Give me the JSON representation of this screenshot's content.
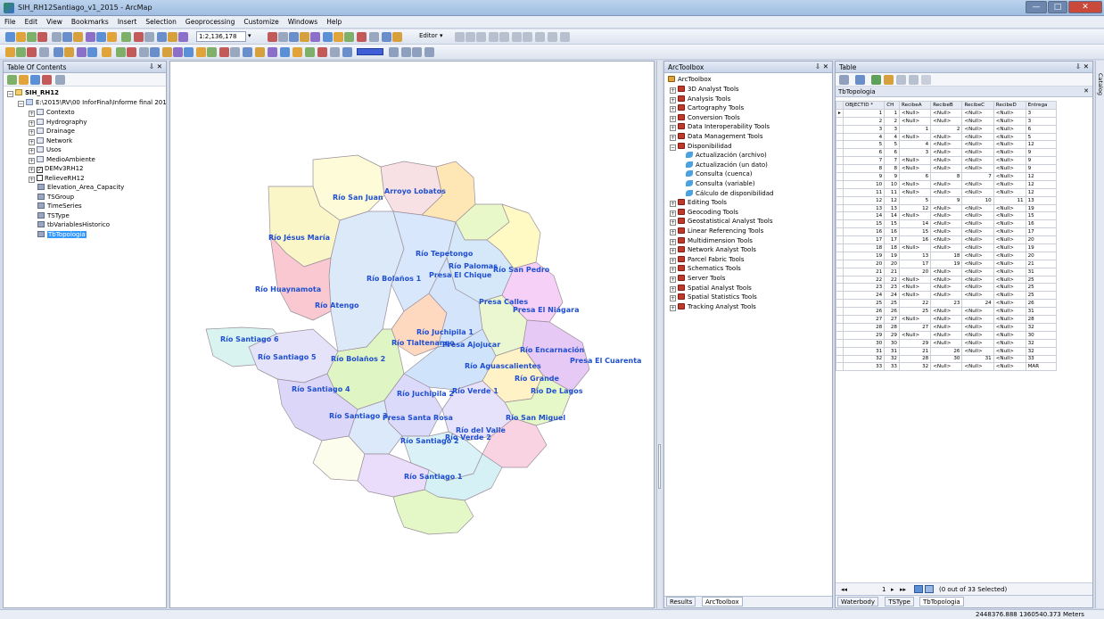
{
  "window": {
    "title": "SIH_RH12Santiago_v1_2015 - ArcMap"
  },
  "menu": [
    "File",
    "Edit",
    "View",
    "Bookmarks",
    "Insert",
    "Selection",
    "Geoprocessing",
    "Customize",
    "Windows",
    "Help"
  ],
  "toolbar": {
    "scale": "1:2,136,178",
    "editor_label": "Editor ▾"
  },
  "toc": {
    "title": "Table Of Contents",
    "root": "SIH_RH12",
    "path": "E:\\2015\\RV\\00 InforFinal\\Informe final 201",
    "groups": [
      "Contexto",
      "Hydrography",
      "Drainage",
      "Network",
      "Usos",
      "MedioAmbiente"
    ],
    "layers": [
      "DEMv3RH12",
      "RelieveRH12"
    ],
    "tables": [
      "Elevation_Area_Capacity",
      "TSGroup",
      "TimeSeries",
      "TSType",
      "tbVariablesHistorico",
      "TbTopologia"
    ]
  },
  "map": {
    "labels": [
      "Río San Juan",
      "Arroyo Lobatos",
      "Río Jésus María",
      "Río Tepetongo",
      "Río Palomas",
      "Presa El Chique",
      "Río San Pedro",
      "Río Bolaños 1",
      "Río Huaynamota",
      "Río Atengo",
      "Presa Calles",
      "Presa El Niágara",
      "Río Juchipila 1",
      "Río Tlaltenango",
      "Presa Ajojucar",
      "Río Encarnación",
      "Río Santiago 6",
      "Río Santiago 5",
      "Río Bolaños 2",
      "Río Aguascalientes",
      "Presa El Cuarenta",
      "Río Grande",
      "Río De Lagos",
      "Río Santiago 4",
      "Río Juchipila 2",
      "Río Verde 1",
      "Río Santiago 3",
      "Presa Santa Rosa",
      "Río San Miguel",
      "Río del Valle",
      "Río Santiago 2",
      "Río Verde 2",
      "Río Santiago 1"
    ]
  },
  "arctoolbox": {
    "title": "ArcToolbox",
    "root": "ArcToolbox",
    "before": [
      "3D Analyst Tools",
      "Analysis Tools",
      "Cartography Tools",
      "Conversion Tools",
      "Data Interoperability Tools",
      "Data Management Tools",
      "Disponibilidad"
    ],
    "tools": [
      "Actualización (archivo)",
      "Actualización (un dato)",
      "Consulta (cuenca)",
      "Consulta (variable)",
      "Cálculo de disponibilidad"
    ],
    "after": [
      "Editing Tools",
      "Geocoding Tools",
      "Geostatistical Analyst Tools",
      "Linear Referencing Tools",
      "Multidimension Tools",
      "Network Analyst Tools",
      "Parcel Fabric Tools",
      "Schematics Tools",
      "Server Tools",
      "Spatial Analyst Tools",
      "Spatial Statistics Tools",
      "Tracking Analyst Tools"
    ],
    "tabs": [
      "Results",
      "ArcToolbox"
    ]
  },
  "table": {
    "title": "Table",
    "table_name": "TbTopologia",
    "columns": [
      "OBJECTID *",
      "CH",
      "RecibeA",
      "RecibeB",
      "RecibeC",
      "RecibeD",
      "Entrega"
    ],
    "rows": [
      [
        "1",
        "1",
        "<Null>",
        "<Null>",
        "<Null>",
        "<Null>",
        "3"
      ],
      [
        "2",
        "2",
        "<Null>",
        "<Null>",
        "<Null>",
        "<Null>",
        "3"
      ],
      [
        "3",
        "3",
        "1",
        "2",
        "<Null>",
        "<Null>",
        "6"
      ],
      [
        "4",
        "4",
        "<Null>",
        "<Null>",
        "<Null>",
        "<Null>",
        "5"
      ],
      [
        "5",
        "5",
        "4",
        "<Null>",
        "<Null>",
        "<Null>",
        "12"
      ],
      [
        "6",
        "6",
        "3",
        "<Null>",
        "<Null>",
        "<Null>",
        "9"
      ],
      [
        "7",
        "7",
        "<Null>",
        "<Null>",
        "<Null>",
        "<Null>",
        "9"
      ],
      [
        "8",
        "8",
        "<Null>",
        "<Null>",
        "<Null>",
        "<Null>",
        "9"
      ],
      [
        "9",
        "9",
        "6",
        "8",
        "7",
        "<Null>",
        "12"
      ],
      [
        "10",
        "10",
        "<Null>",
        "<Null>",
        "<Null>",
        "<Null>",
        "12"
      ],
      [
        "11",
        "11",
        "<Null>",
        "<Null>",
        "<Null>",
        "<Null>",
        "12"
      ],
      [
        "12",
        "12",
        "5",
        "9",
        "10",
        "11",
        "13"
      ],
      [
        "13",
        "13",
        "12",
        "<Null>",
        "<Null>",
        "<Null>",
        "19"
      ],
      [
        "14",
        "14",
        "<Null>",
        "<Null>",
        "<Null>",
        "<Null>",
        "15"
      ],
      [
        "15",
        "15",
        "14",
        "<Null>",
        "<Null>",
        "<Null>",
        "16"
      ],
      [
        "16",
        "16",
        "15",
        "<Null>",
        "<Null>",
        "<Null>",
        "17"
      ],
      [
        "17",
        "17",
        "16",
        "<Null>",
        "<Null>",
        "<Null>",
        "20"
      ],
      [
        "18",
        "18",
        "<Null>",
        "<Null>",
        "<Null>",
        "<Null>",
        "19"
      ],
      [
        "19",
        "19",
        "13",
        "18",
        "<Null>",
        "<Null>",
        "20"
      ],
      [
        "20",
        "20",
        "17",
        "19",
        "<Null>",
        "<Null>",
        "21"
      ],
      [
        "21",
        "21",
        "20",
        "<Null>",
        "<Null>",
        "<Null>",
        "31"
      ],
      [
        "22",
        "22",
        "<Null>",
        "<Null>",
        "<Null>",
        "<Null>",
        "25"
      ],
      [
        "23",
        "23",
        "<Null>",
        "<Null>",
        "<Null>",
        "<Null>",
        "25"
      ],
      [
        "24",
        "24",
        "<Null>",
        "<Null>",
        "<Null>",
        "<Null>",
        "25"
      ],
      [
        "25",
        "25",
        "22",
        "23",
        "24",
        "<Null>",
        "26"
      ],
      [
        "26",
        "26",
        "25",
        "<Null>",
        "<Null>",
        "<Null>",
        "31"
      ],
      [
        "27",
        "27",
        "<Null>",
        "<Null>",
        "<Null>",
        "<Null>",
        "28"
      ],
      [
        "28",
        "28",
        "27",
        "<Null>",
        "<Null>",
        "<Null>",
        "32"
      ],
      [
        "29",
        "29",
        "<Null>",
        "<Null>",
        "<Null>",
        "<Null>",
        "30"
      ],
      [
        "30",
        "30",
        "29",
        "<Null>",
        "<Null>",
        "<Null>",
        "32"
      ],
      [
        "31",
        "31",
        "21",
        "26",
        "<Null>",
        "<Null>",
        "32"
      ],
      [
        "32",
        "32",
        "28",
        "30",
        "31",
        "<Null>",
        "33"
      ],
      [
        "33",
        "33",
        "32",
        "<Null>",
        "<Null>",
        "<Null>",
        "MAR"
      ]
    ],
    "nav_record": "1",
    "selection_status": "(0 out of 33 Selected)",
    "tabs": [
      "Waterbody",
      "TSType",
      "TbTopologia"
    ],
    "catalog_label": "Catalog"
  },
  "status": {
    "coordinates": "2448376.888  1360540.373 Meters"
  }
}
